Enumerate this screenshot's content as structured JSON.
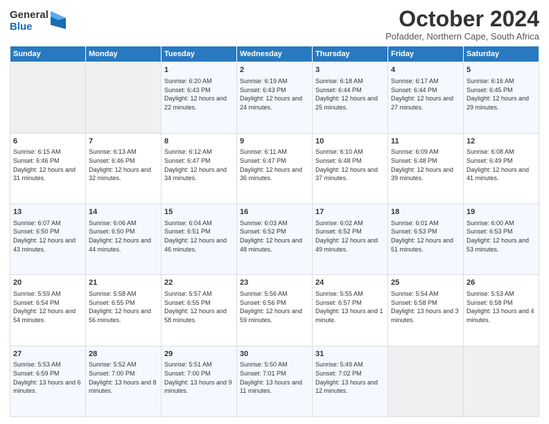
{
  "logo": {
    "general": "General",
    "blue": "Blue"
  },
  "header": {
    "title": "October 2024",
    "location": "Pofadder, Northern Cape, South Africa"
  },
  "calendar": {
    "headers": [
      "Sunday",
      "Monday",
      "Tuesday",
      "Wednesday",
      "Thursday",
      "Friday",
      "Saturday"
    ],
    "weeks": [
      [
        {
          "date": "",
          "info": ""
        },
        {
          "date": "",
          "info": ""
        },
        {
          "date": "1",
          "info": "Sunrise: 6:20 AM\nSunset: 6:43 PM\nDaylight: 12 hours and 22 minutes."
        },
        {
          "date": "2",
          "info": "Sunrise: 6:19 AM\nSunset: 6:43 PM\nDaylight: 12 hours and 24 minutes."
        },
        {
          "date": "3",
          "info": "Sunrise: 6:18 AM\nSunset: 6:44 PM\nDaylight: 12 hours and 25 minutes."
        },
        {
          "date": "4",
          "info": "Sunrise: 6:17 AM\nSunset: 6:44 PM\nDaylight: 12 hours and 27 minutes."
        },
        {
          "date": "5",
          "info": "Sunrise: 6:16 AM\nSunset: 6:45 PM\nDaylight: 12 hours and 29 minutes."
        }
      ],
      [
        {
          "date": "6",
          "info": "Sunrise: 6:15 AM\nSunset: 6:46 PM\nDaylight: 12 hours and 31 minutes."
        },
        {
          "date": "7",
          "info": "Sunrise: 6:13 AM\nSunset: 6:46 PM\nDaylight: 12 hours and 32 minutes."
        },
        {
          "date": "8",
          "info": "Sunrise: 6:12 AM\nSunset: 6:47 PM\nDaylight: 12 hours and 34 minutes."
        },
        {
          "date": "9",
          "info": "Sunrise: 6:11 AM\nSunset: 6:47 PM\nDaylight: 12 hours and 36 minutes."
        },
        {
          "date": "10",
          "info": "Sunrise: 6:10 AM\nSunset: 6:48 PM\nDaylight: 12 hours and 37 minutes."
        },
        {
          "date": "11",
          "info": "Sunrise: 6:09 AM\nSunset: 6:48 PM\nDaylight: 12 hours and 39 minutes."
        },
        {
          "date": "12",
          "info": "Sunrise: 6:08 AM\nSunset: 6:49 PM\nDaylight: 12 hours and 41 minutes."
        }
      ],
      [
        {
          "date": "13",
          "info": "Sunrise: 6:07 AM\nSunset: 6:50 PM\nDaylight: 12 hours and 43 minutes."
        },
        {
          "date": "14",
          "info": "Sunrise: 6:06 AM\nSunset: 6:50 PM\nDaylight: 12 hours and 44 minutes."
        },
        {
          "date": "15",
          "info": "Sunrise: 6:04 AM\nSunset: 6:51 PM\nDaylight: 12 hours and 46 minutes."
        },
        {
          "date": "16",
          "info": "Sunrise: 6:03 AM\nSunset: 6:52 PM\nDaylight: 12 hours and 48 minutes."
        },
        {
          "date": "17",
          "info": "Sunrise: 6:02 AM\nSunset: 6:52 PM\nDaylight: 12 hours and 49 minutes."
        },
        {
          "date": "18",
          "info": "Sunrise: 6:01 AM\nSunset: 6:53 PM\nDaylight: 12 hours and 51 minutes."
        },
        {
          "date": "19",
          "info": "Sunrise: 6:00 AM\nSunset: 6:53 PM\nDaylight: 12 hours and 53 minutes."
        }
      ],
      [
        {
          "date": "20",
          "info": "Sunrise: 5:59 AM\nSunset: 6:54 PM\nDaylight: 12 hours and 54 minutes."
        },
        {
          "date": "21",
          "info": "Sunrise: 5:58 AM\nSunset: 6:55 PM\nDaylight: 12 hours and 56 minutes."
        },
        {
          "date": "22",
          "info": "Sunrise: 5:57 AM\nSunset: 6:55 PM\nDaylight: 12 hours and 58 minutes."
        },
        {
          "date": "23",
          "info": "Sunrise: 5:56 AM\nSunset: 6:56 PM\nDaylight: 12 hours and 59 minutes."
        },
        {
          "date": "24",
          "info": "Sunrise: 5:55 AM\nSunset: 6:57 PM\nDaylight: 13 hours and 1 minute."
        },
        {
          "date": "25",
          "info": "Sunrise: 5:54 AM\nSunset: 6:58 PM\nDaylight: 13 hours and 3 minutes."
        },
        {
          "date": "26",
          "info": "Sunrise: 5:53 AM\nSunset: 6:58 PM\nDaylight: 13 hours and 4 minutes."
        }
      ],
      [
        {
          "date": "27",
          "info": "Sunrise: 5:53 AM\nSunset: 6:59 PM\nDaylight: 13 hours and 6 minutes."
        },
        {
          "date": "28",
          "info": "Sunrise: 5:52 AM\nSunset: 7:00 PM\nDaylight: 13 hours and 8 minutes."
        },
        {
          "date": "29",
          "info": "Sunrise: 5:51 AM\nSunset: 7:00 PM\nDaylight: 13 hours and 9 minutes."
        },
        {
          "date": "30",
          "info": "Sunrise: 5:50 AM\nSunset: 7:01 PM\nDaylight: 13 hours and 11 minutes."
        },
        {
          "date": "31",
          "info": "Sunrise: 5:49 AM\nSunset: 7:02 PM\nDaylight: 13 hours and 12 minutes."
        },
        {
          "date": "",
          "info": ""
        },
        {
          "date": "",
          "info": ""
        }
      ]
    ]
  }
}
